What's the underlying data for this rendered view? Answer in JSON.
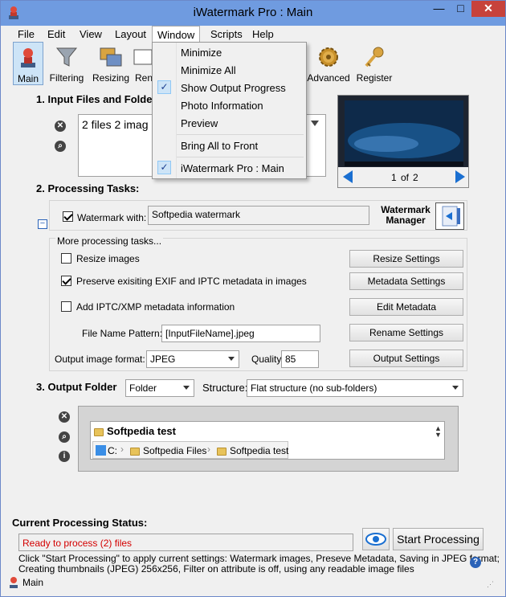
{
  "window": {
    "title": "iWatermark Pro : Main",
    "minimize_glyph": "—",
    "maximize_glyph": "□",
    "close_glyph": "✕"
  },
  "menu": {
    "items": [
      "File",
      "Edit",
      "View",
      "Layout",
      "Window",
      "Scripts",
      "Help"
    ],
    "active": "Window"
  },
  "window_menu": {
    "items": [
      {
        "label": "Minimize",
        "checked": false
      },
      {
        "label": "Minimize All",
        "checked": false
      },
      {
        "label": "Show Output Progress",
        "checked": true
      },
      {
        "label": "Photo Information",
        "checked": false
      },
      {
        "label": "Preview",
        "checked": false
      },
      {
        "label": "Bring All to Front",
        "checked": false
      },
      {
        "label": "iWatermark Pro : Main",
        "checked": true
      }
    ]
  },
  "toolbar": {
    "main": "Main",
    "filtering": "Filtering",
    "resizing": "Resizing",
    "ren": "Ren",
    "advanced": "Advanced",
    "register": "Register"
  },
  "input_files": {
    "title": "1. Input Files and Folde",
    "summary": "2 files 2 imag",
    "page_current": "1",
    "page_of": "of",
    "page_total": "2"
  },
  "processing": {
    "title": "2. Processing Tasks:",
    "watermark_checked": true,
    "watermark_label": "Watermark with:",
    "watermark_value": "Softpedia watermark",
    "watermark_manager": "Watermark Manager",
    "more_tasks": "More processing tasks...",
    "resize_label": "Resize images",
    "resize_checked": false,
    "resize_button": "Resize Settings",
    "metadata_label": "Preserve exisiting EXIF and IPTC metadata in images",
    "metadata_checked": true,
    "metadata_button": "Metadata Settings",
    "iptc_label": "Add IPTC/XMP metadata information",
    "iptc_checked": false,
    "iptc_button": "Edit Metadata",
    "pattern_label": "File Name Pattern:",
    "pattern_value": "[InputFileName].jpeg",
    "rename_button": "Rename Settings",
    "format_label": "Output image format:",
    "format_value": "JPEG",
    "quality_label": "Quality:",
    "quality_value": "85",
    "output_button": "Output Settings"
  },
  "output": {
    "title": "3. Output Folder",
    "folder_type": "Folder",
    "structure_label": "Structure:",
    "structure_value": "Flat structure (no sub-folders)",
    "folder_name": "Softpedia test",
    "path": [
      "C:",
      "Softpedia Files",
      "Softpedia test"
    ]
  },
  "status": {
    "title": "Current Processing Status:",
    "message": "Ready to process (2) files",
    "start_button": "Start Processing",
    "description_line1": "Click \"Start Processing\" to apply current settings: Watermark images, Preseve Metadata, Saving in JPEG format;",
    "description_line2": "Creating thumbnails (JPEG) 256x256, Filter on attribute is off, using any readable image files",
    "bottom_label": "Main",
    "help_glyph": "?"
  },
  "colors": {
    "titlebar": "#6f9be0",
    "close": "#c7423b",
    "status_red": "#d40000",
    "selection": "#cde4f7"
  }
}
